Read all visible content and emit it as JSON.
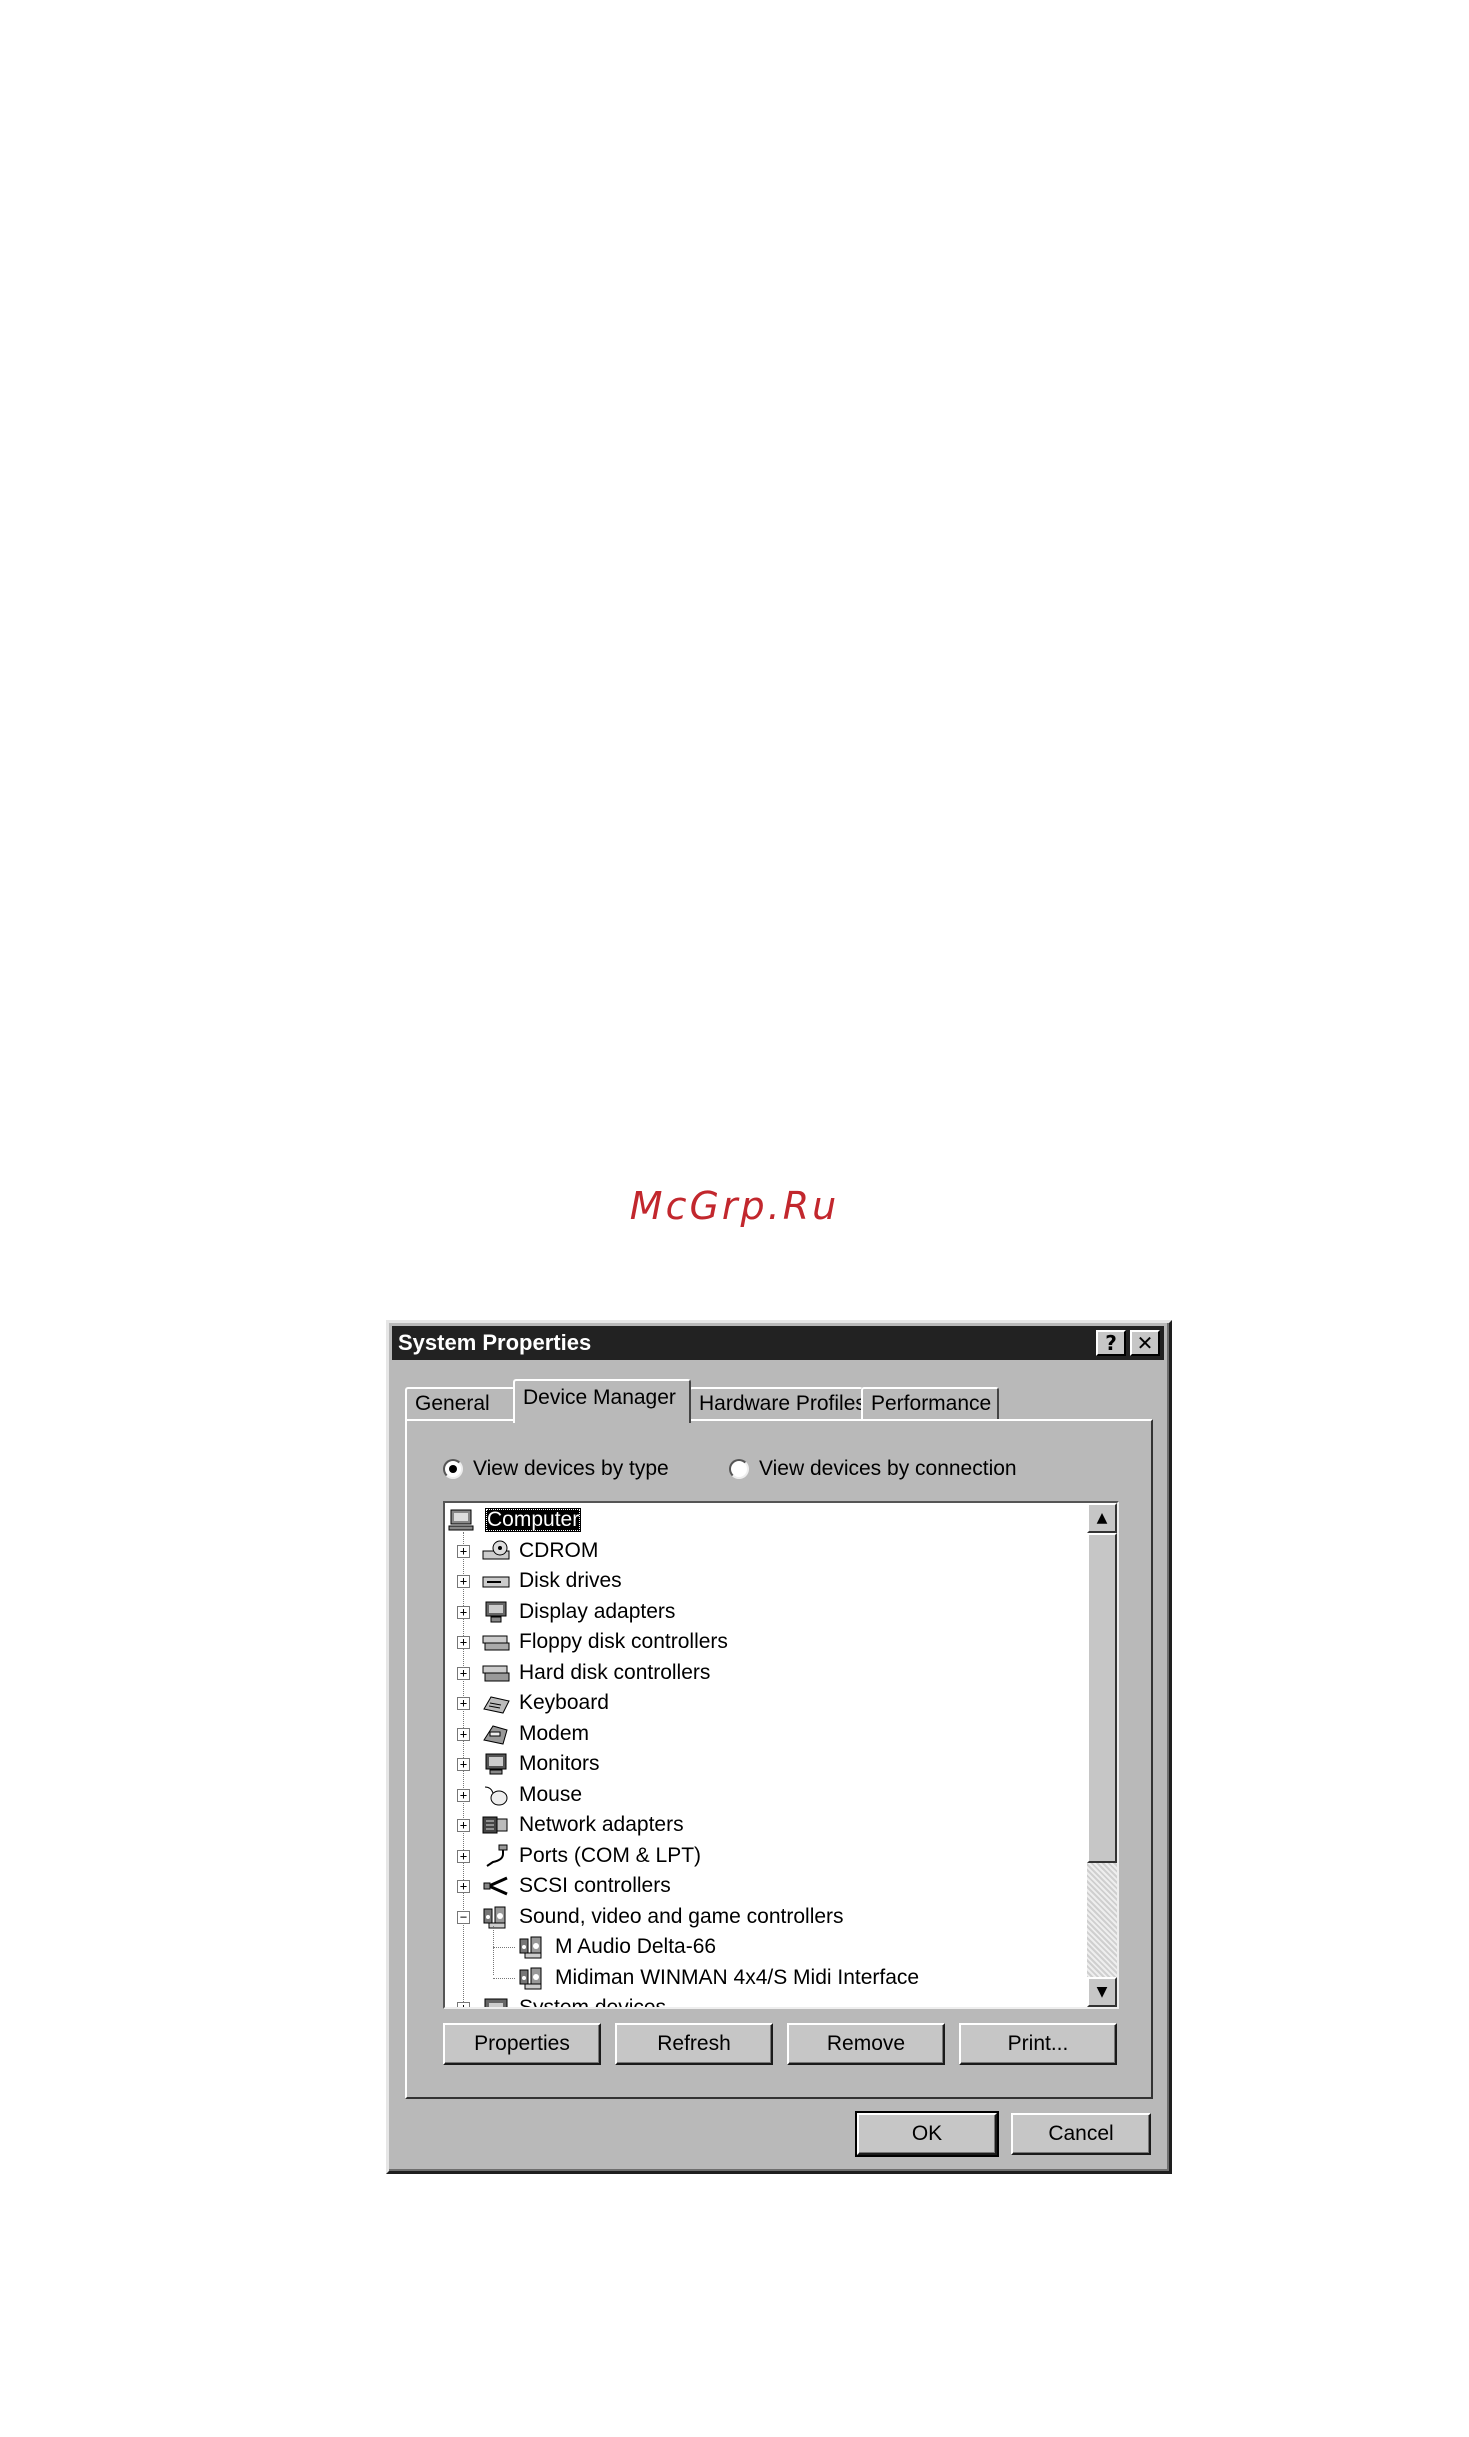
{
  "watermark": "McGrp.Ru",
  "window": {
    "title": "System Properties",
    "help_glyph": "?",
    "close_glyph": "✕"
  },
  "tabs": [
    {
      "label": "General",
      "active": false
    },
    {
      "label": "Device Manager",
      "active": true
    },
    {
      "label": "Hardware Profiles",
      "active": false
    },
    {
      "label": "Performance",
      "active": false
    }
  ],
  "view_options": {
    "by_type": "View devices by type",
    "by_connection": "View devices by connection",
    "selected": "by_type"
  },
  "tree": {
    "root": {
      "label": "Computer",
      "icon": "computer-icon"
    },
    "items": [
      {
        "label": "CDROM",
        "icon": "cdrom-icon",
        "expanded": false
      },
      {
        "label": "Disk drives",
        "icon": "disk-drive-icon",
        "expanded": false
      },
      {
        "label": "Display adapters",
        "icon": "display-adapter-icon",
        "expanded": false
      },
      {
        "label": "Floppy disk controllers",
        "icon": "floppy-controller-icon",
        "expanded": false
      },
      {
        "label": "Hard disk controllers",
        "icon": "hard-disk-controller-icon",
        "expanded": false
      },
      {
        "label": "Keyboard",
        "icon": "keyboard-icon",
        "expanded": false
      },
      {
        "label": "Modem",
        "icon": "modem-icon",
        "expanded": false
      },
      {
        "label": "Monitors",
        "icon": "monitor-icon",
        "expanded": false
      },
      {
        "label": "Mouse",
        "icon": "mouse-icon",
        "expanded": false
      },
      {
        "label": "Network adapters",
        "icon": "network-adapter-icon",
        "expanded": false
      },
      {
        "label": "Ports (COM & LPT)",
        "icon": "port-icon",
        "expanded": false
      },
      {
        "label": "SCSI controllers",
        "icon": "scsi-icon",
        "expanded": false
      },
      {
        "label": "Sound, video and game controllers",
        "icon": "sound-icon",
        "expanded": true,
        "children": [
          {
            "label": "M Audio Delta-66",
            "icon": "sound-icon"
          },
          {
            "label": "Midiman WINMAN 4x4/S Midi Interface",
            "icon": "sound-icon"
          }
        ]
      },
      {
        "label": "System devices",
        "icon": "system-device-icon",
        "expanded": false
      }
    ]
  },
  "buttons": {
    "properties": "Properties",
    "refresh": "Refresh",
    "remove": "Remove",
    "print": "Print...",
    "ok": "OK",
    "cancel": "Cancel"
  }
}
